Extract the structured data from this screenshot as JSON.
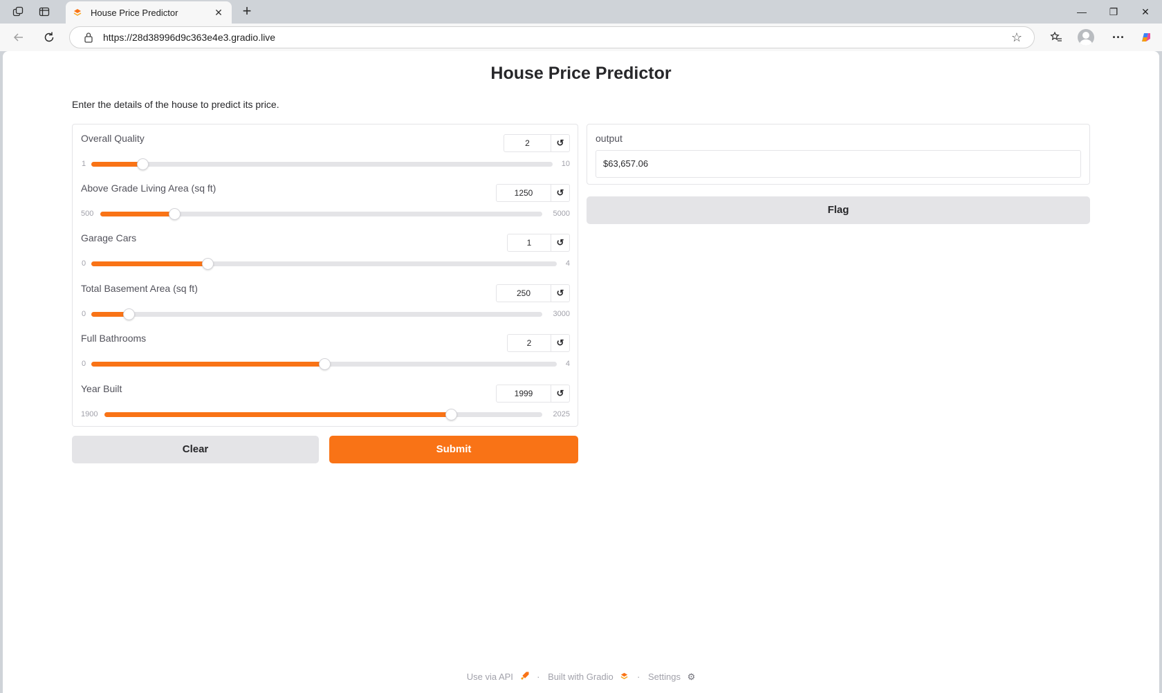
{
  "browser": {
    "tab_title": "House Price Predictor",
    "tab_close": "✕",
    "new_tab": "+",
    "url": "https://28d38996d9c363e4e3.gradio.live",
    "window_controls": {
      "minimize": "—",
      "restore": "❐",
      "close": "✕"
    }
  },
  "page": {
    "title": "House Price Predictor",
    "description": "Enter the details of the house to predict its price."
  },
  "sliders": [
    {
      "label": "Overall Quality",
      "value": "2",
      "min": "1",
      "max": "10",
      "fraction": 0.111
    },
    {
      "label": "Above Grade Living Area (sq ft)",
      "value": "1250",
      "min": "500",
      "max": "5000",
      "fraction": 0.167
    },
    {
      "label": "Garage Cars",
      "value": "1",
      "min": "0",
      "max": "4",
      "fraction": 0.25
    },
    {
      "label": "Total Basement Area (sq ft)",
      "value": "250",
      "min": "0",
      "max": "3000",
      "fraction": 0.083
    },
    {
      "label": "Full Bathrooms",
      "value": "2",
      "min": "0",
      "max": "4",
      "fraction": 0.5
    },
    {
      "label": "Year Built",
      "value": "1999",
      "min": "1900",
      "max": "2025",
      "fraction": 0.792
    }
  ],
  "reset_icon": "↺",
  "buttons": {
    "clear": "Clear",
    "submit": "Submit",
    "flag": "Flag"
  },
  "output": {
    "label": "output",
    "value": "$63,657.06"
  },
  "footer": {
    "api": "Use via API",
    "built": "Built with Gradio",
    "settings": "Settings",
    "separator": "·"
  },
  "colors": {
    "accent": "#f97316",
    "secondary_button": "#e4e4e7",
    "track": "#e4e4e7"
  }
}
